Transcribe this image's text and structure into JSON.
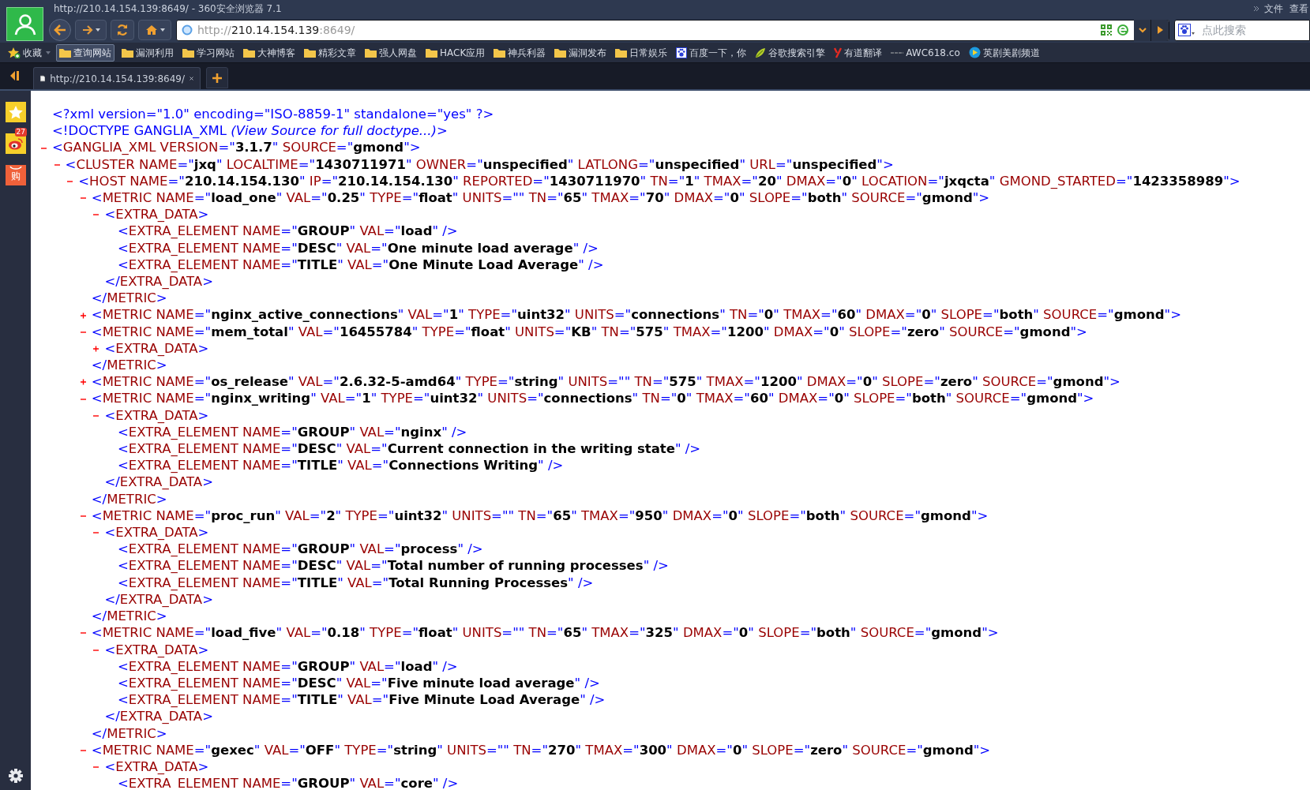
{
  "window": {
    "title": "http://210.14.154.139:8649/ - 360安全浏览器 7.1",
    "menu": [
      "文件",
      "查看"
    ]
  },
  "address_bar": {
    "scheme": "http://",
    "host": "210.14.154.139",
    "port_path": ":8649/"
  },
  "search": {
    "placeholder": "点此搜索"
  },
  "bookmarks": [
    {
      "kind": "favorites",
      "label": "收藏",
      "selected": false
    },
    {
      "kind": "folder",
      "label": "查询网站",
      "selected": true
    },
    {
      "kind": "folder",
      "label": "漏洞利用",
      "selected": false
    },
    {
      "kind": "folder",
      "label": "学习网站",
      "selected": false
    },
    {
      "kind": "folder",
      "label": "大神博客",
      "selected": false
    },
    {
      "kind": "folder",
      "label": "精彩文章",
      "selected": false
    },
    {
      "kind": "folder",
      "label": "强人网盘",
      "selected": false
    },
    {
      "kind": "folder",
      "label": "HACK应用",
      "selected": false
    },
    {
      "kind": "folder",
      "label": "神兵利器",
      "selected": false
    },
    {
      "kind": "folder",
      "label": "漏洞发布",
      "selected": false
    },
    {
      "kind": "folder",
      "label": "日常娱乐",
      "selected": false
    },
    {
      "kind": "paw",
      "label": "百度一下，你",
      "selected": false
    },
    {
      "kind": "sprout",
      "label": "谷歌搜索引擎",
      "selected": false
    },
    {
      "kind": "letter",
      "label": "有道翻译",
      "selected": false
    },
    {
      "kind": "dash",
      "label": "AWC618.co",
      "selected": false
    },
    {
      "kind": "play",
      "label": "英剧美剧频道",
      "selected": false
    }
  ],
  "tabs": [
    {
      "label": "http://210.14.154.139:8649/",
      "selected": true
    }
  ],
  "sidebar": {
    "items": [
      {
        "kind": "star"
      },
      {
        "kind": "eye",
        "badge": "27"
      },
      {
        "kind": "bag",
        "label": "购"
      }
    ]
  },
  "document": {
    "prolog": [
      {
        "text": "<?xml version=\"1.0\" encoding=\"ISO-8859-1\" standalone=\"yes\" ?>"
      },
      {
        "text": "<!DOCTYPE GANGLIA_XML *(View Source for full doctype...)*>"
      }
    ],
    "tree": {
      "open": "<GANGLIA_XML VERSION=\"**3.1.7**\" SOURCE=\"**gmond**\">",
      "expanded": true,
      "children": [
        {
          "open": "<CLUSTER NAME=\"**jxq**\" LOCALTIME=\"**1430711971**\" OWNER=\"**unspecified**\" LATLONG=\"**unspecified**\" URL=\"**unspecified**\">",
          "expanded": true,
          "children": [
            {
              "open": "<HOST NAME=\"**210.14.154.130**\" IP=\"**210.14.154.130**\" REPORTED=\"**1430711970**\" TN=\"**1**\" TMAX=\"**20**\" DMAX=\"**0**\" LOCATION=\"**jxqcta**\" GMOND_STARTED=\"**1423358989**\">",
              "expanded": true,
              "children": [
                {
                  "open": "<METRIC NAME=\"**load_one**\" VAL=\"**0.25**\" TYPE=\"**float**\" UNITS=\"\" TN=\"**65**\" TMAX=\"**70**\" DMAX=\"**0**\" SLOPE=\"**both**\" SOURCE=\"**gmond**\">",
                  "expanded": true,
                  "children": [
                    {
                      "open": "<EXTRA_DATA>",
                      "expanded": true,
                      "children": [
                        {
                          "open": "<EXTRA_ELEMENT NAME=\"**GROUP**\" VAL=\"**load**\" />"
                        },
                        {
                          "open": "<EXTRA_ELEMENT NAME=\"**DESC**\" VAL=\"**One minute load average**\" />"
                        },
                        {
                          "open": "<EXTRA_ELEMENT NAME=\"**TITLE**\" VAL=\"**One Minute Load Average**\" />"
                        }
                      ],
                      "close": "</EXTRA_DATA>"
                    }
                  ],
                  "close": "</METRIC>"
                },
                {
                  "open": "<METRIC NAME=\"**nginx_active_connections**\" VAL=\"**1**\" TYPE=\"**uint32**\" UNITS=\"**connections**\" TN=\"**0**\" TMAX=\"**60**\" DMAX=\"**0**\" SLOPE=\"**both**\" SOURCE=\"**gmond**\">",
                  "expanded": false
                },
                {
                  "open": "<METRIC NAME=\"**mem_total**\" VAL=\"**16455784**\" TYPE=\"**float**\" UNITS=\"**KB**\" TN=\"**575**\" TMAX=\"**1200**\" DMAX=\"**0**\" SLOPE=\"**zero**\" SOURCE=\"**gmond**\">",
                  "expanded": true,
                  "children": [
                    {
                      "open": "<EXTRA_DATA>",
                      "expanded": false
                    }
                  ],
                  "close": "</METRIC>"
                },
                {
                  "open": "<METRIC NAME=\"**os_release**\" VAL=\"**2.6.32-5-amd64**\" TYPE=\"**string**\" UNITS=\"\" TN=\"**575**\" TMAX=\"**1200**\" DMAX=\"**0**\" SLOPE=\"**zero**\" SOURCE=\"**gmond**\">",
                  "expanded": false
                },
                {
                  "open": "<METRIC NAME=\"**nginx_writing**\" VAL=\"**1**\" TYPE=\"**uint32**\" UNITS=\"**connections**\" TN=\"**0**\" TMAX=\"**60**\" DMAX=\"**0**\" SLOPE=\"**both**\" SOURCE=\"**gmond**\">",
                  "expanded": true,
                  "children": [
                    {
                      "open": "<EXTRA_DATA>",
                      "expanded": true,
                      "children": [
                        {
                          "open": "<EXTRA_ELEMENT NAME=\"**GROUP**\" VAL=\"**nginx**\" />"
                        },
                        {
                          "open": "<EXTRA_ELEMENT NAME=\"**DESC**\" VAL=\"**Current connection in the writing state**\" />"
                        },
                        {
                          "open": "<EXTRA_ELEMENT NAME=\"**TITLE**\" VAL=\"**Connections Writing**\" />"
                        }
                      ],
                      "close": "</EXTRA_DATA>"
                    }
                  ],
                  "close": "</METRIC>"
                },
                {
                  "open": "<METRIC NAME=\"**proc_run**\" VAL=\"**2**\" TYPE=\"**uint32**\" UNITS=\"\" TN=\"**65**\" TMAX=\"**950**\" DMAX=\"**0**\" SLOPE=\"**both**\" SOURCE=\"**gmond**\">",
                  "expanded": true,
                  "children": [
                    {
                      "open": "<EXTRA_DATA>",
                      "expanded": true,
                      "children": [
                        {
                          "open": "<EXTRA_ELEMENT NAME=\"**GROUP**\" VAL=\"**process**\" />"
                        },
                        {
                          "open": "<EXTRA_ELEMENT NAME=\"**DESC**\" VAL=\"**Total number of running processes**\" />"
                        },
                        {
                          "open": "<EXTRA_ELEMENT NAME=\"**TITLE**\" VAL=\"**Total Running Processes**\" />"
                        }
                      ],
                      "close": "</EXTRA_DATA>"
                    }
                  ],
                  "close": "</METRIC>"
                },
                {
                  "open": "<METRIC NAME=\"**load_five**\" VAL=\"**0.18**\" TYPE=\"**float**\" UNITS=\"\" TN=\"**65**\" TMAX=\"**325**\" DMAX=\"**0**\" SLOPE=\"**both**\" SOURCE=\"**gmond**\">",
                  "expanded": true,
                  "children": [
                    {
                      "open": "<EXTRA_DATA>",
                      "expanded": true,
                      "children": [
                        {
                          "open": "<EXTRA_ELEMENT NAME=\"**GROUP**\" VAL=\"**load**\" />"
                        },
                        {
                          "open": "<EXTRA_ELEMENT NAME=\"**DESC**\" VAL=\"**Five minute load average**\" />"
                        },
                        {
                          "open": "<EXTRA_ELEMENT NAME=\"**TITLE**\" VAL=\"**Five Minute Load Average**\" />"
                        }
                      ],
                      "close": "</EXTRA_DATA>"
                    }
                  ],
                  "close": "</METRIC>"
                },
                {
                  "open": "<METRIC NAME=\"**gexec**\" VAL=\"**OFF**\" TYPE=\"**string**\" UNITS=\"\" TN=\"**270**\" TMAX=\"**300**\" DMAX=\"**0**\" SLOPE=\"**zero**\" SOURCE=\"**gmond**\">",
                  "expanded": true,
                  "children": [
                    {
                      "open": "<EXTRA_DATA>",
                      "expanded": true,
                      "children": [
                        {
                          "open": "<EXTRA_ELEMENT NAME=\"**GROUP**\" VAL=\"**core**\" />"
                        }
                      ]
                    }
                  ]
                }
              ]
            }
          ]
        }
      ]
    }
  }
}
